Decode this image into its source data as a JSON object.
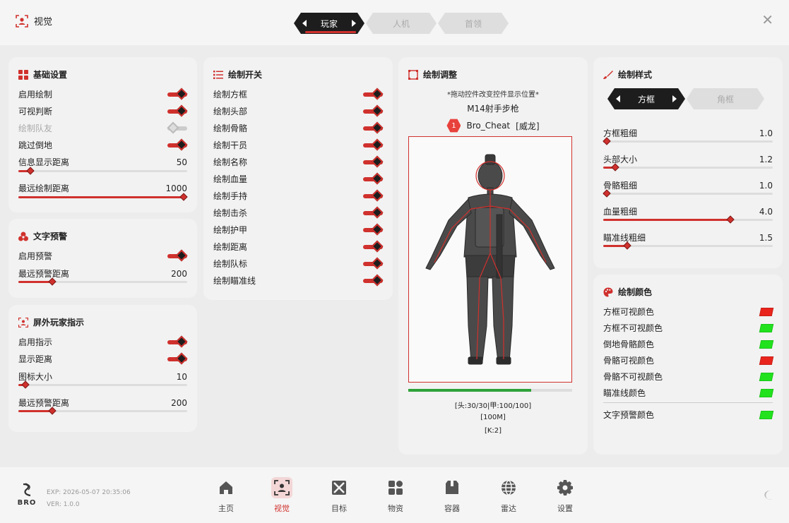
{
  "app": {
    "title": "视觉"
  },
  "top_tabs": [
    {
      "label": "玩家",
      "active": true
    },
    {
      "label": "人机",
      "active": false
    },
    {
      "label": "首领",
      "active": false
    }
  ],
  "basic": {
    "title": "基础设置",
    "toggles": [
      {
        "label": "启用绘制",
        "on": true
      },
      {
        "label": "可视判断",
        "on": true
      },
      {
        "label": "绘制队友",
        "on": false
      },
      {
        "label": "跳过倒地",
        "on": true
      }
    ],
    "sliders": [
      {
        "label": "信息显示距离",
        "value": "50",
        "fraction": 0.07
      },
      {
        "label": "最远绘制距离",
        "value": "1000",
        "fraction": 1.0
      }
    ]
  },
  "text_warn": {
    "title": "文字预警",
    "toggle": {
      "label": "启用预警",
      "on": true
    },
    "slider": {
      "label": "最远预警距离",
      "value": "200",
      "fraction": 0.2
    }
  },
  "offscreen": {
    "title": "屏外玩家指示",
    "toggles": [
      {
        "label": "启用指示",
        "on": true
      },
      {
        "label": "显示距离",
        "on": true
      }
    ],
    "sliders": [
      {
        "label": "图标大小",
        "value": "10",
        "fraction": 0.04
      },
      {
        "label": "最远预警距离",
        "value": "200",
        "fraction": 0.2
      }
    ]
  },
  "draw_switch": {
    "title": "绘制开关",
    "toggles": [
      {
        "label": "绘制方框",
        "on": true
      },
      {
        "label": "绘制头部",
        "on": true
      },
      {
        "label": "绘制骨骼",
        "on": true
      },
      {
        "label": "绘制干员",
        "on": true
      },
      {
        "label": "绘制名称",
        "on": true
      },
      {
        "label": "绘制血量",
        "on": true
      },
      {
        "label": "绘制手持",
        "on": true
      },
      {
        "label": "绘制击杀",
        "on": true
      },
      {
        "label": "绘制护甲",
        "on": true
      },
      {
        "label": "绘制距离",
        "on": true
      },
      {
        "label": "绘制队标",
        "on": true
      },
      {
        "label": "绘制瞄准线",
        "on": true
      }
    ]
  },
  "preview": {
    "title": "绘制调整",
    "hint": "*拖动控件改变控件显示位置*",
    "weapon": "M14射手步枪",
    "team_no": "1",
    "player": "Bro_Cheat",
    "operator": "[威龙]",
    "hp_fraction": 0.75,
    "info_line1": "[头:30/30|甲:100/100]",
    "info_line2": "[100M]",
    "info_line3": "[K:2]"
  },
  "style": {
    "title": "绘制样式",
    "tabs": [
      {
        "label": "方框",
        "active": true
      },
      {
        "label": "角框",
        "active": false
      }
    ],
    "sliders": [
      {
        "label": "方框粗细",
        "value": "1.0",
        "fraction": 0.0
      },
      {
        "label": "头部大小",
        "value": "1.2",
        "fraction": 0.05
      },
      {
        "label": "骨骼粗细",
        "value": "1.0",
        "fraction": 0.0
      },
      {
        "label": "血量粗细",
        "value": "4.0",
        "fraction": 0.75
      },
      {
        "label": "瞄准线粗细",
        "value": "1.5",
        "fraction": 0.12
      }
    ]
  },
  "colors": {
    "title": "绘制颜色",
    "items": [
      {
        "label": "方框可视颜色",
        "color": "#e8241c"
      },
      {
        "label": "方框不可视颜色",
        "color": "#21e21d"
      },
      {
        "label": "倒地骨骼颜色",
        "color": "#21e21d"
      },
      {
        "label": "骨骼可视颜色",
        "color": "#e8241c"
      },
      {
        "label": "骨骼不可视颜色",
        "color": "#21e21d"
      },
      {
        "label": "瞄准线颜色",
        "color": "#21e21d"
      },
      {
        "label": "文字预警颜色",
        "color": "#21e21d"
      }
    ]
  },
  "footer": {
    "logo_text": "BRO",
    "exp": "EXP: 2026-05-07 20:35:06",
    "ver": "VER: 1.0.0",
    "nav": [
      {
        "label": "主页",
        "icon": "home-icon",
        "active": false
      },
      {
        "label": "视觉",
        "icon": "eye-user-icon",
        "active": true
      },
      {
        "label": "目标",
        "icon": "target-icon",
        "active": false
      },
      {
        "label": "物资",
        "icon": "grid-icon",
        "active": false
      },
      {
        "label": "容器",
        "icon": "box-icon",
        "active": false
      },
      {
        "label": "雷达",
        "icon": "globe-icon",
        "active": false
      },
      {
        "label": "设置",
        "icon": "gear-icon",
        "active": false
      }
    ]
  },
  "theme": {
    "accent": "#d0312d",
    "dark": "#1d1d1d",
    "hp_green": "#2fa23a"
  }
}
